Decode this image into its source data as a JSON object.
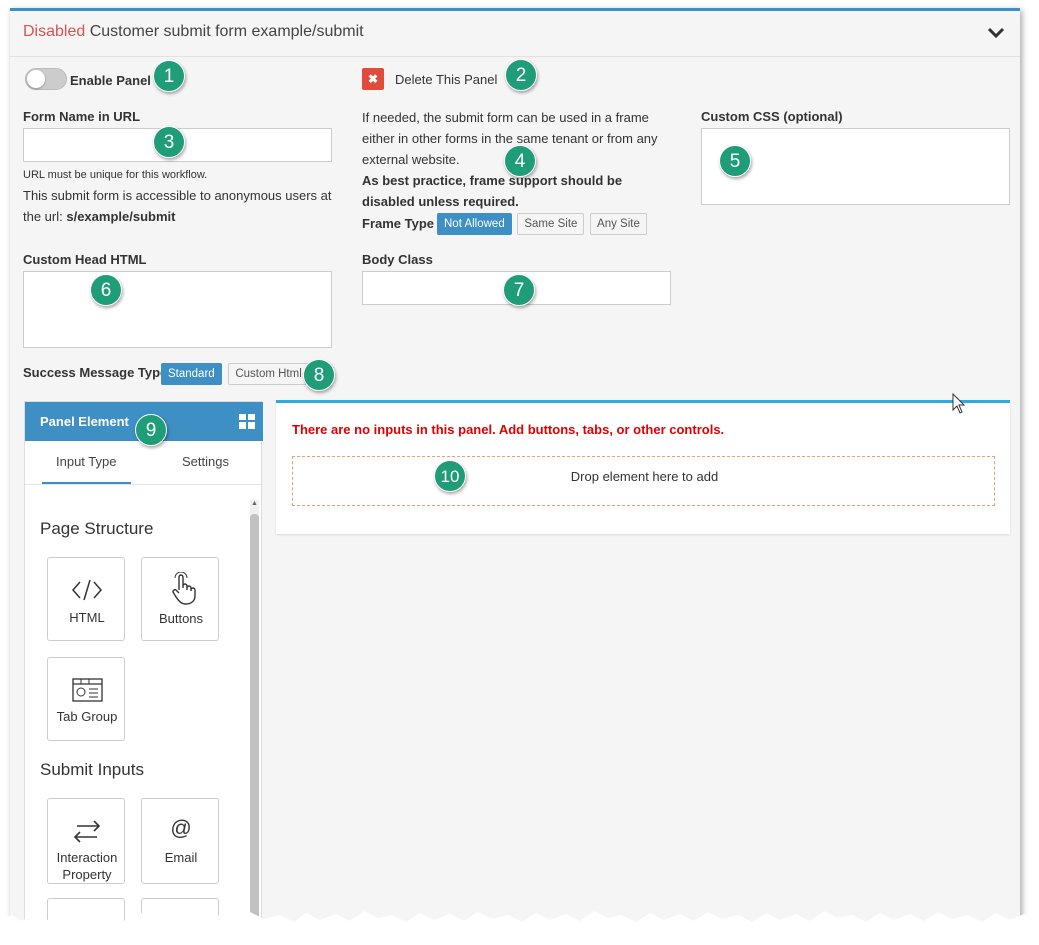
{
  "header": {
    "status": "Disabled",
    "title": "Customer submit form example/submit"
  },
  "enable_panel": {
    "label": "Enable Panel",
    "enabled": false
  },
  "delete_panel": {
    "label": "Delete This Panel"
  },
  "form_name": {
    "label": "Form Name in URL",
    "value": "",
    "hint": "URL must be unique for this workflow.",
    "access_text": "This submit form is accessible to anonymous users at",
    "access_prefix": "the url: ",
    "url": "s/example/submit"
  },
  "frame": {
    "desc_line1": "If needed, the submit form can be used in a frame",
    "desc_line2": "either in other forms in the same tenant or from any",
    "desc_line3": "external website.",
    "warn_line1": "As best practice, frame support should be",
    "warn_line2": "disabled unless required.",
    "type_label": "Frame Type",
    "options": [
      "Not Allowed",
      "Same Site",
      "Any Site"
    ],
    "selected": "Not Allowed"
  },
  "custom_css": {
    "label": "Custom CSS (optional)",
    "value": ""
  },
  "custom_head_html": {
    "label": "Custom Head HTML",
    "value": ""
  },
  "body_class": {
    "label": "Body Class",
    "value": ""
  },
  "success_message": {
    "label": "Success Message Type",
    "options": [
      "Standard",
      "Custom Html"
    ],
    "selected": "Standard"
  },
  "panel_element": {
    "title": "Panel Element",
    "tabs": [
      "Input Type",
      "Settings"
    ],
    "active_tab": "Input Type",
    "sections": [
      {
        "title": "Page Structure",
        "items": [
          {
            "label": "HTML",
            "icon": "code-icon"
          },
          {
            "label": "Buttons",
            "icon": "pointer-hand-icon"
          },
          {
            "label": "Tab Group",
            "icon": "tab-group-icon"
          }
        ]
      },
      {
        "title": "Submit Inputs",
        "items": [
          {
            "label": "Interaction Property",
            "icon": "swap-arrows-icon"
          },
          {
            "label": "Email",
            "icon": "at-sign-icon"
          }
        ]
      }
    ]
  },
  "drop_panel": {
    "warning": "There are no inputs in this panel. Add buttons, tabs, or other controls.",
    "drop_text": "Drop element here to add"
  },
  "callouts": [
    "1",
    "2",
    "3",
    "4",
    "5",
    "6",
    "7",
    "8",
    "9",
    "10"
  ],
  "colors": {
    "accent": "#3d8fc4",
    "disabled": "#d9534f",
    "callout": "#1f9c78",
    "warning": "#e00000"
  }
}
